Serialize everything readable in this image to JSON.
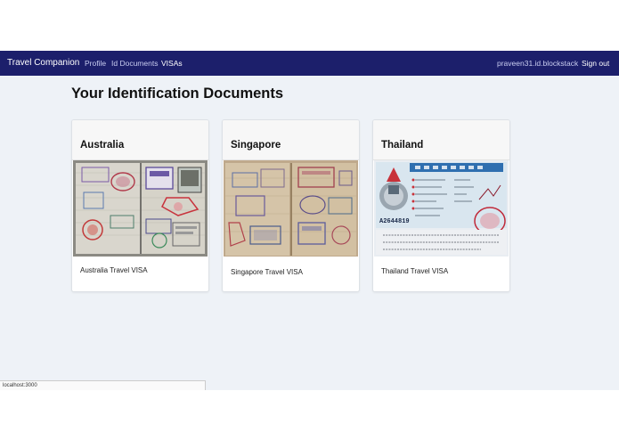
{
  "nav": {
    "brand": "Travel Companion",
    "links": [
      "Profile",
      "Id Documents",
      "VISAs"
    ],
    "user": "praveen31.id.blockstack",
    "signout": "Sign out"
  },
  "page": {
    "title": "Your Identification Documents"
  },
  "cards": [
    {
      "title": "Australia",
      "caption": "Australia Travel VISA"
    },
    {
      "title": "Singapore",
      "caption": "Singapore Travel VISA"
    },
    {
      "title": "Thailand",
      "caption": "Thailand Travel VISA",
      "visa_number": "A2644819"
    }
  ],
  "status": {
    "url": "localhost:3000"
  },
  "colors": {
    "navbar": "#1c1f6b",
    "background": "#eef2f7"
  }
}
